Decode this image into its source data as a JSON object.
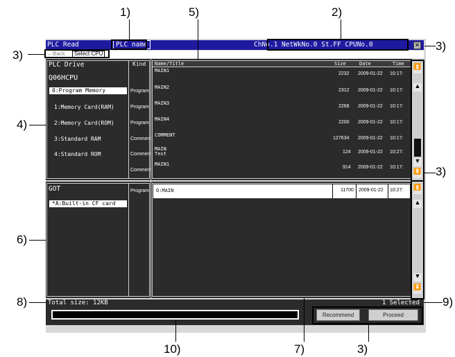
{
  "callouts": {
    "c1": "1)",
    "c2": "2)",
    "c3": "3)",
    "c4": "4)",
    "c5": "5)",
    "c6": "6)",
    "c7": "7)",
    "c8": "8)",
    "c9": "9)",
    "c10": "10)"
  },
  "titlebar": {
    "title": "PLC Read",
    "plc_name_button": "PLC name",
    "connection": "ChNo.1 NetWkNo.0 St.FF CPUNo.0",
    "close_icon": "close-icon"
  },
  "toolbar": {
    "back_label": "←Back",
    "select_cpu_label": "Select CPU"
  },
  "plc_drive": {
    "header_label": "PLC Drive",
    "kind_header": "Kind",
    "cpu_name": "Q06HCPU",
    "items": [
      {
        "label": "0:Program Memory",
        "kind": "Program",
        "selected": true
      },
      {
        "label": "1:Memory Card(RAM)",
        "kind": "Program",
        "selected": false
      },
      {
        "label": "2:Memory Card(ROM)",
        "kind": "Program",
        "selected": false
      },
      {
        "label": "3:Standard RAM",
        "kind": "Comment",
        "selected": false
      },
      {
        "label": "4:Standard ROM",
        "kind": "Comment",
        "selected": false
      },
      {
        "label": "",
        "kind": "Comment",
        "selected": false
      }
    ]
  },
  "file_list": {
    "headers": {
      "name": "Name/Title",
      "size": "Size",
      "date": "Date",
      "time": "Time"
    },
    "rows": [
      {
        "name": "MAIN1",
        "title": "",
        "size": "2232",
        "date": "2009-01-22",
        "time": "10:17:"
      },
      {
        "name": "MAIN2",
        "title": "",
        "size": "2312",
        "date": "2009-01-22",
        "time": "10:17:"
      },
      {
        "name": "MAIN3",
        "title": "",
        "size": "2268",
        "date": "2009-01-22",
        "time": "10:17:"
      },
      {
        "name": "MAIN4",
        "title": "",
        "size": "2200",
        "date": "2009-01-22",
        "time": "10:17:"
      },
      {
        "name": "COMMENT",
        "title": "",
        "size": "127634",
        "date": "2009-01-22",
        "time": "10:17:"
      },
      {
        "name": "MAIN",
        "title": "Test",
        "size": "124",
        "date": "2009-01-22",
        "time": "10:27:"
      },
      {
        "name": "MAIN1",
        "title": "",
        "size": "914",
        "date": "2009-01-22",
        "time": "10:17:"
      }
    ]
  },
  "got": {
    "header_label": "GOT",
    "kind": "Program",
    "items": [
      {
        "label": "*A:Built-in CF card",
        "selected": true
      }
    ]
  },
  "got_files": {
    "rows": [
      {
        "name": "O:MAIN",
        "size": "11700",
        "date": "2009-01-22",
        "time": "10:27:"
      }
    ]
  },
  "status": {
    "total_size": "Total size: 12KB",
    "selected": "1 Selected"
  },
  "buttons": {
    "recommend": "Recommend",
    "proceed": "Proceed"
  }
}
